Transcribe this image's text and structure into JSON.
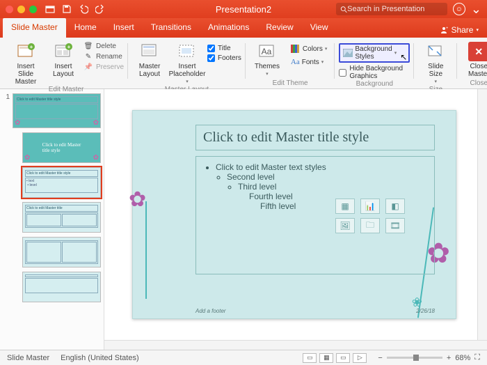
{
  "window": {
    "title": "Presentation2"
  },
  "search": {
    "placeholder": "Search in Presentation"
  },
  "share": {
    "label": "Share"
  },
  "tabs": [
    "Slide Master",
    "Home",
    "Insert",
    "Transitions",
    "Animations",
    "Review",
    "View"
  ],
  "active_tab": 0,
  "ribbon": {
    "edit_master": {
      "insert_slide_master": "Insert Slide\nMaster",
      "insert_layout": "Insert\nLayout",
      "delete": "Delete",
      "rename": "Rename",
      "preserve": "Preserve",
      "group": "Edit Master"
    },
    "master_layout": {
      "master_layout": "Master\nLayout",
      "insert_placeholder": "Insert\nPlaceholder",
      "title": "Title",
      "footers": "Footers",
      "group": "Master Layout"
    },
    "edit_theme": {
      "themes": "Themes",
      "colors": "Colors",
      "fonts": "Fonts",
      "group": "Edit Theme"
    },
    "background": {
      "styles": "Background Styles",
      "hide": "Hide Background Graphics",
      "group": "Background"
    },
    "size": {
      "slide_size": "Slide\nSize",
      "group": "Size"
    },
    "close": {
      "close_master": "Close\nMaster",
      "group": "Close"
    }
  },
  "thumbs": {
    "num": "1",
    "tooltip_title": "Click to edit Master title style"
  },
  "slide": {
    "title": "Click to edit Master title style",
    "body": {
      "l1": "Click to edit Master text styles",
      "l2": "Second level",
      "l3": "Third level",
      "l4": "Fourth level",
      "l5": "Fifth level"
    },
    "footer_left": "Add a footer",
    "footer_right": "2/26/18"
  },
  "status": {
    "mode": "Slide Master",
    "lang": "English (United States)",
    "zoom": "68%"
  }
}
